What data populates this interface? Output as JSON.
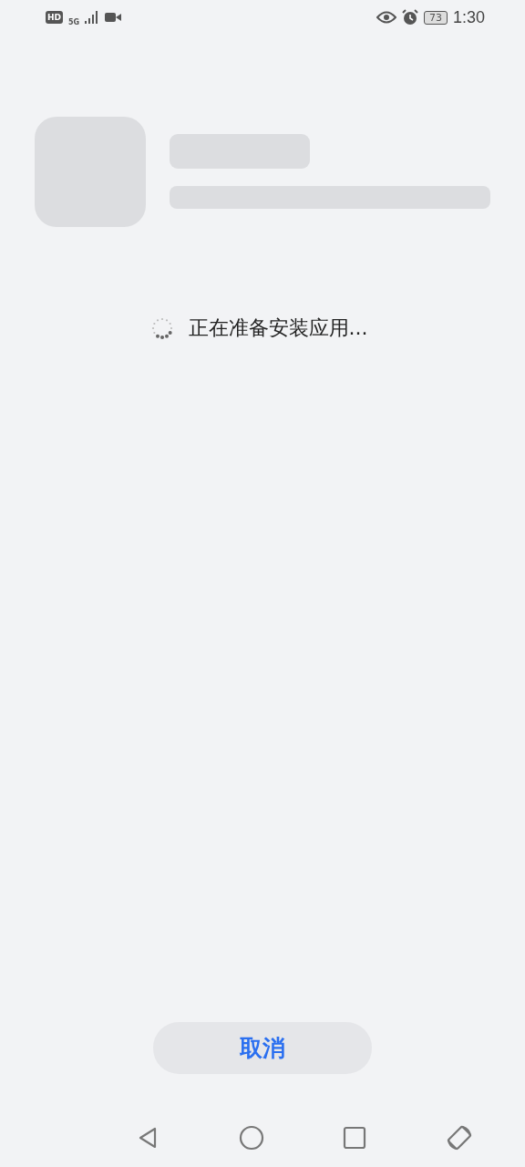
{
  "status_bar": {
    "hd": "HD",
    "network": "5G",
    "battery": "73",
    "time": "1:30"
  },
  "status": {
    "message": "正在准备安装应用..."
  },
  "buttons": [
    {
      "label": "取消"
    }
  ]
}
